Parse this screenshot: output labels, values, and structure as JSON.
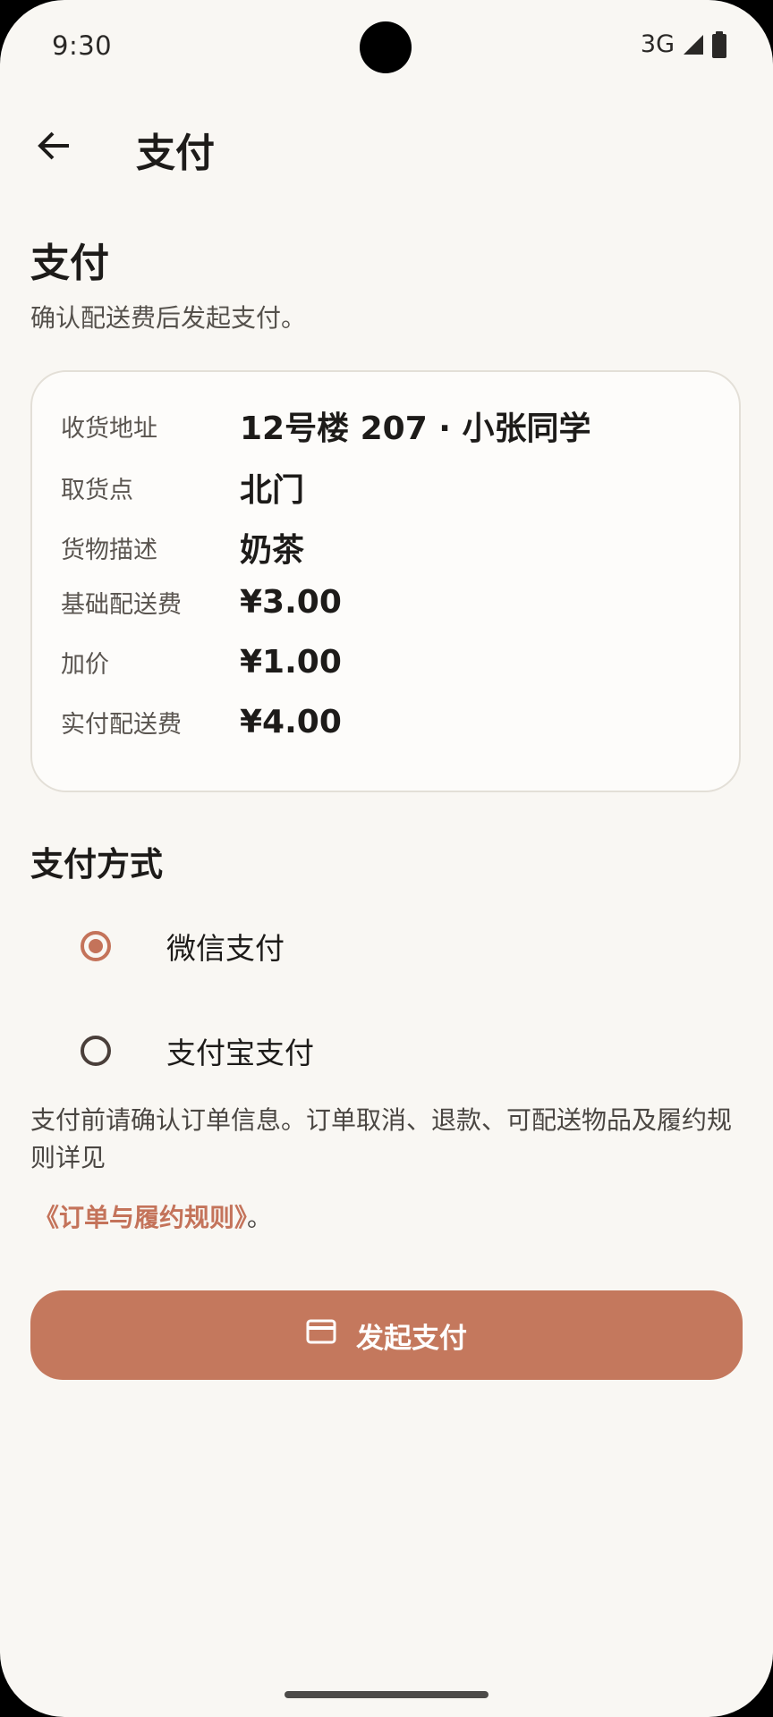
{
  "status_bar": {
    "time": "9:30",
    "network": "3G",
    "icons": [
      "signal-icon",
      "battery-icon"
    ]
  },
  "app_bar": {
    "back_icon": "arrow-left-icon",
    "title": "支付"
  },
  "header": {
    "heading": "支付",
    "subtitle": "确认配送费后发起支付。"
  },
  "summary": {
    "rows": [
      {
        "label": "收货地址",
        "value": "12号楼 207 · 小张同学"
      },
      {
        "label": "取货点",
        "value": "北门"
      },
      {
        "label": "货物描述",
        "value": "奶茶"
      },
      {
        "label": "基础配送费",
        "value": "¥3.00"
      },
      {
        "label": "加价",
        "value": "¥1.00"
      },
      {
        "label": "实付配送费",
        "value": "¥4.00"
      }
    ]
  },
  "payment": {
    "section_title": "支付方式",
    "options": [
      {
        "label": "微信支付",
        "selected": true
      },
      {
        "label": "支付宝支付",
        "selected": false
      }
    ]
  },
  "notice": {
    "text": "支付前请确认订单信息。订单取消、退款、可配送物品及履约规则详见",
    "link": "《订单与履约规则》",
    "suffix": "。"
  },
  "pay_button": {
    "icon": "credit-card-icon",
    "label": "发起支付"
  },
  "colors": {
    "accent": "#c4785d",
    "background": "#f9f7f3",
    "card": "#fdfcfa"
  }
}
